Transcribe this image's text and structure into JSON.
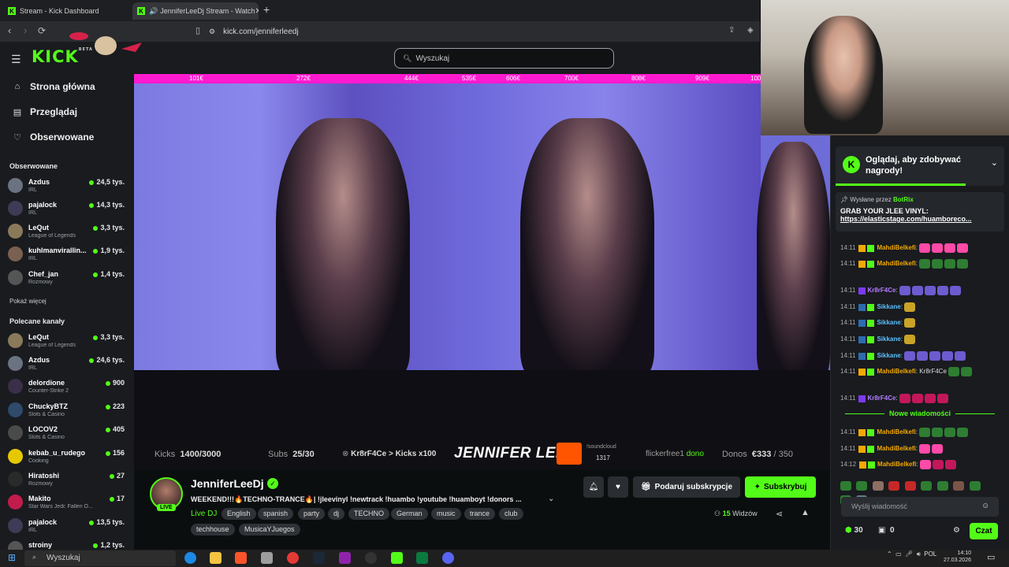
{
  "browser": {
    "tabs": [
      {
        "label": "Stream - Kick Dashboard"
      },
      {
        "label": "JenniferLeeDj Stream - Watch"
      }
    ],
    "url": "kick.com/jenniferleedj"
  },
  "header": {
    "logo": "KICK",
    "logo_beta": "BETA",
    "search_placeholder": "Wyszukaj"
  },
  "sidebar": {
    "nav": [
      {
        "label": "Strona główna",
        "icon": "home-icon"
      },
      {
        "label": "Przeglądaj",
        "icon": "browse-icon"
      },
      {
        "label": "Obserwowane",
        "icon": "heart-icon"
      }
    ],
    "followed_title": "Obserwowane",
    "followed": [
      {
        "name": "Azdus",
        "category": "IRL",
        "viewers": "24,5 tys."
      },
      {
        "name": "pajalock",
        "category": "IRL",
        "viewers": "14,3 tys."
      },
      {
        "name": "LeQut",
        "category": "League of Legends",
        "viewers": "3,3 tys."
      },
      {
        "name": "kuhlmanvirallin...",
        "category": "IRL",
        "viewers": "1,9 tys."
      },
      {
        "name": "Chef_jan",
        "category": "Rozmowy",
        "viewers": "1,4 tys."
      }
    ],
    "show_more": "Pokaż więcej",
    "recommended_title": "Polecane kanały",
    "recommended": [
      {
        "name": "LeQut",
        "category": "League of Legends",
        "viewers": "3,3 tys."
      },
      {
        "name": "Azdus",
        "category": "IRL",
        "viewers": "24,6 tys."
      },
      {
        "name": "delordione",
        "category": "Counter-Strike 2",
        "viewers": "900"
      },
      {
        "name": "ChuckyBTZ",
        "category": "Slots & Casino",
        "viewers": "223"
      },
      {
        "name": "LOCOV2",
        "category": "Slots & Casino",
        "viewers": "405"
      },
      {
        "name": "kebab_u_rudego",
        "category": "Cooking",
        "viewers": "156"
      },
      {
        "name": "Hiratoshi",
        "category": "Rozmowy",
        "viewers": "27"
      },
      {
        "name": "Makito",
        "category": "Star Wars Jedi: Fallen O...",
        "viewers": "17"
      },
      {
        "name": "pajalock",
        "category": "IRL",
        "viewers": "13,5 tys."
      },
      {
        "name": "stroiny",
        "category": "",
        "viewers": "1,2 tys."
      }
    ]
  },
  "player": {
    "donation_marks": [
      "101€",
      "272€",
      "444€",
      "535€",
      "606€",
      "700€",
      "808€",
      "909€",
      "100"
    ],
    "overlay": {
      "kicks_label": "Kicks",
      "kicks_value": "1400/3000",
      "subs_label": "Subs",
      "subs_value": "25/30",
      "event": "Kr8rF4Ce > Kicks x100",
      "brand": "JENNIFER LEE",
      "soundcloud_label": "!soundcloud",
      "soundcloud_value": "1317",
      "dono_user": "flickerfree1",
      "dono_word": "dono",
      "donos_label": "Donos",
      "donos_value": "€333",
      "donos_goal": "/ 350"
    }
  },
  "stream": {
    "channel": "JenniferLeeDj",
    "live": "LIVE",
    "title": "WEEKEND!!!🔥TECHNO-TRANCE🔥| !jleevinyl !newtrack !huambo  !youtube !huamboyt  !donors ...",
    "category": "Live DJ",
    "tags": [
      "English",
      "spanish",
      "party",
      "dj",
      "TECHNO",
      "German",
      "music",
      "trance",
      "club",
      "techhouse",
      "MusicaYJuegos"
    ],
    "gift_label": "Podaruj subskrypcje",
    "subscribe_label": "Subskrybuj",
    "viewers_count": "15",
    "viewers_word": "Widzów"
  },
  "chat": {
    "reward_title": "Oglądaj, aby zdobywać nagrody!",
    "pinned_by": "Wysłane przez",
    "pinned_user": "BotRix",
    "pinned_line1": "GRAB YOUR JLEE VINYL:",
    "pinned_line2": "https://elasticstage.com/huamboreco...",
    "messages": [
      {
        "time": "14:11",
        "user": "MahdiBelkefi",
        "text": "",
        "color": "#f2a900"
      },
      {
        "time": "14:11",
        "user": "MahdiBelkefi",
        "text": "",
        "color": "#f2a900"
      },
      {
        "time": "14:11",
        "user": "Kr8rF4Ce",
        "text": "",
        "color": "#b57cff"
      },
      {
        "time": "14:11",
        "user": "Sikkane",
        "text": "",
        "color": "#5bc0ff"
      },
      {
        "time": "14:11",
        "user": "Sikkane",
        "text": "",
        "color": "#5bc0ff"
      },
      {
        "time": "14:11",
        "user": "Sikkane",
        "text": "",
        "color": "#5bc0ff"
      },
      {
        "time": "14:11",
        "user": "Sikkane",
        "text": "",
        "color": "#5bc0ff"
      },
      {
        "time": "14:11",
        "user": "MahdiBelkefi",
        "text": "Kr8rF4Ce",
        "color": "#f2a900"
      },
      {
        "time": "14:11",
        "user": "Kr8rF4Ce",
        "text": "",
        "color": "#b57cff"
      }
    ],
    "new_messages": "Nowe wiadomości",
    "new": [
      {
        "time": "14:11",
        "user": "MahdiBelkefi",
        "text": "",
        "color": "#f2a900"
      },
      {
        "time": "14:11",
        "user": "MahdiBelkefi",
        "text": "",
        "color": "#f2a900"
      },
      {
        "time": "14:12",
        "user": "MahdiBelkefi",
        "text": "",
        "color": "#f2a900"
      }
    ],
    "input_placeholder": "Wyślij wiadomość",
    "points": "30",
    "gifts": "0",
    "send_label": "Czat"
  },
  "taskbar": {
    "search": "Wyszukaj",
    "lang": "POL",
    "time": "14:10",
    "date": "27.03.2026"
  },
  "colors": {
    "accent": "#53fc18",
    "background": "#0b0e0f",
    "panel": "#191b1f"
  }
}
